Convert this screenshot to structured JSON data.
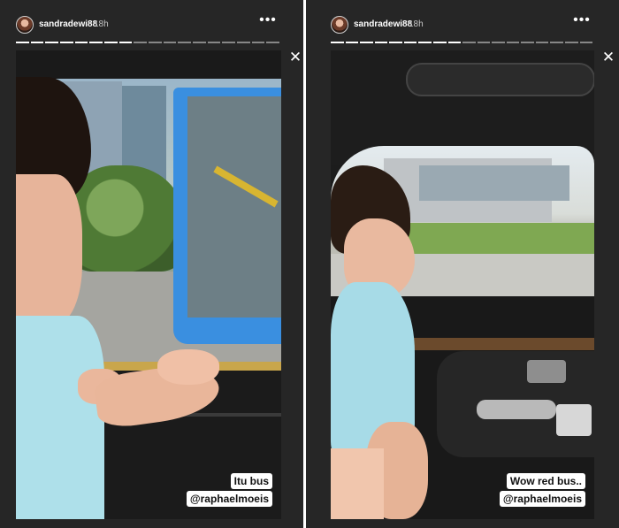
{
  "stories": [
    {
      "username": "sandradewi88",
      "time": "18h",
      "more_icon": "more-horizontal-icon",
      "close_icon": "close-icon",
      "caption_line1": "Itu bus",
      "caption_line2": "@raphaelmoeis"
    },
    {
      "username": "sandradewi88",
      "time": "18h",
      "more_icon": "more-horizontal-icon",
      "close_icon": "close-icon",
      "caption_line1": "Wow red bus..",
      "caption_line2": "@raphaelmoeis"
    }
  ],
  "colors": {
    "background": "#262626",
    "text": "#ffffff",
    "caption_bg": "#ffffff",
    "caption_text": "#111111"
  }
}
